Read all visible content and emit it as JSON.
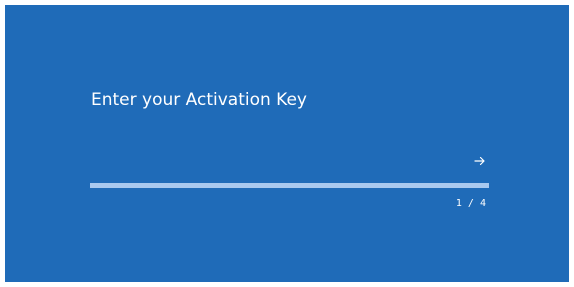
{
  "activation": {
    "title": "Enter your Activation Key",
    "key_value": "",
    "next_icon": "arrow-right-icon",
    "progress": 1.0,
    "step": "1 / 4"
  },
  "colors": {
    "background": "#1f6bb8",
    "progress_fill": "#a9c9ef",
    "text": "#ffffff"
  }
}
